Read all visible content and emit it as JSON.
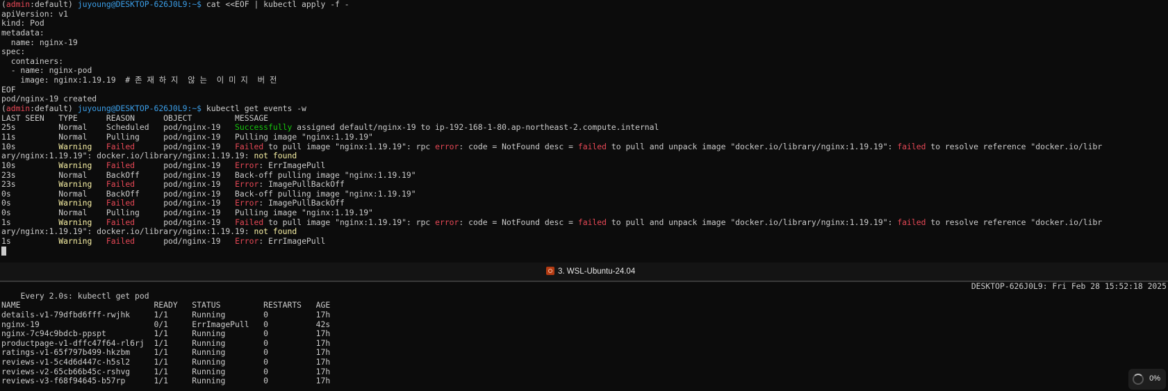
{
  "colors": {
    "background": "#0c0c0c",
    "text": "#cccccc",
    "red": "#e74856",
    "yellow": "#f9f1a5",
    "green": "#16c60c",
    "cyan": "#3b9ee8"
  },
  "prompt": {
    "open": "(",
    "user": "admin",
    "colon": ":",
    "ns": "default",
    "close": ") ",
    "host": "juyoung@DESKTOP-626J0L9:~$"
  },
  "top_lines": [
    [
      {
        "t": "(",
        "c": ""
      },
      {
        "t": "admin",
        "c": "red"
      },
      {
        "t": ":default) ",
        "c": ""
      },
      {
        "t": "juyoung@DESKTOP-626J0L9:~$",
        "c": "cyan"
      },
      {
        "t": " cat <<EOF | kubectl apply -f -",
        "c": ""
      }
    ],
    [
      {
        "t": "apiVersion: v1",
        "c": ""
      }
    ],
    [
      {
        "t": "kind: Pod",
        "c": ""
      }
    ],
    [
      {
        "t": "metadata:",
        "c": ""
      }
    ],
    [
      {
        "t": "  name: nginx-19",
        "c": ""
      }
    ],
    [
      {
        "t": "spec:",
        "c": ""
      }
    ],
    [
      {
        "t": "  containers:",
        "c": ""
      }
    ],
    [
      {
        "t": "  - name: nginx-pod",
        "c": ""
      }
    ],
    [
      {
        "t": "    image: nginx:1.19.19  # 존 재 하 지  않 는  이 미 지  버 전",
        "c": ""
      }
    ],
    [
      {
        "t": "EOF",
        "c": ""
      }
    ],
    [
      {
        "t": "pod/nginx-19 created",
        "c": ""
      }
    ],
    [
      {
        "t": "(",
        "c": ""
      },
      {
        "t": "admin",
        "c": "red"
      },
      {
        "t": ":default) ",
        "c": ""
      },
      {
        "t": "juyoung@DESKTOP-626J0L9:~$",
        "c": "cyan"
      },
      {
        "t": " kubectl get events -w",
        "c": ""
      }
    ],
    [
      {
        "t": "LAST SEEN   TYPE      REASON      OBJECT         MESSAGE",
        "c": ""
      }
    ],
    [
      {
        "t": "25s         Normal    Scheduled   pod/nginx-19   ",
        "c": ""
      },
      {
        "t": "Successfully",
        "c": "green"
      },
      {
        "t": " assigned default/nginx-19 to ip-192-168-1-80.ap-northeast-2.compute.internal",
        "c": ""
      }
    ],
    [
      {
        "t": "11s         Normal    Pulling     pod/nginx-19   Pulling image \"nginx:1.19.19\"",
        "c": ""
      }
    ],
    [
      {
        "t": "10s         ",
        "c": ""
      },
      {
        "t": "Warning",
        "c": "yellow"
      },
      {
        "t": "   ",
        "c": ""
      },
      {
        "t": "Failed",
        "c": "red"
      },
      {
        "t": "      pod/nginx-19   ",
        "c": ""
      },
      {
        "t": "Failed",
        "c": "red"
      },
      {
        "t": " to pull image \"nginx:1.19.19\": rpc ",
        "c": ""
      },
      {
        "t": "error",
        "c": "red"
      },
      {
        "t": ": code = NotFound desc = ",
        "c": ""
      },
      {
        "t": "failed",
        "c": "red"
      },
      {
        "t": " to pull and unpack image \"docker.io/library/nginx:1.19.19\": ",
        "c": ""
      },
      {
        "t": "failed",
        "c": "red"
      },
      {
        "t": " to resolve reference \"docker.io/libr",
        "c": ""
      }
    ],
    [
      {
        "t": "ary/nginx:1.19.19\": docker.io/library/nginx:1.19.19: ",
        "c": ""
      },
      {
        "t": "not found",
        "c": "yellow"
      }
    ],
    [
      {
        "t": "10s         ",
        "c": ""
      },
      {
        "t": "Warning",
        "c": "yellow"
      },
      {
        "t": "   ",
        "c": ""
      },
      {
        "t": "Failed",
        "c": "red"
      },
      {
        "t": "      pod/nginx-19   ",
        "c": ""
      },
      {
        "t": "Error",
        "c": "red"
      },
      {
        "t": ": ErrImagePull",
        "c": ""
      }
    ],
    [
      {
        "t": "23s         Normal    BackOff     pod/nginx-19   Back-off pulling image \"nginx:1.19.19\"",
        "c": ""
      }
    ],
    [
      {
        "t": "23s         ",
        "c": ""
      },
      {
        "t": "Warning",
        "c": "yellow"
      },
      {
        "t": "   ",
        "c": ""
      },
      {
        "t": "Failed",
        "c": "red"
      },
      {
        "t": "      pod/nginx-19   ",
        "c": ""
      },
      {
        "t": "Error",
        "c": "red"
      },
      {
        "t": ": ImagePullBackOff",
        "c": ""
      }
    ],
    [
      {
        "t": "0s          Normal    BackOff     pod/nginx-19   Back-off pulling image \"nginx:1.19.19\"",
        "c": ""
      }
    ],
    [
      {
        "t": "0s          ",
        "c": ""
      },
      {
        "t": "Warning",
        "c": "yellow"
      },
      {
        "t": "   ",
        "c": ""
      },
      {
        "t": "Failed",
        "c": "red"
      },
      {
        "t": "      pod/nginx-19   ",
        "c": ""
      },
      {
        "t": "Error",
        "c": "red"
      },
      {
        "t": ": ImagePullBackOff",
        "c": ""
      }
    ],
    [
      {
        "t": "0s          Normal    Pulling     pod/nginx-19   Pulling image \"nginx:1.19.19\"",
        "c": ""
      }
    ],
    [
      {
        "t": "1s          ",
        "c": ""
      },
      {
        "t": "Warning",
        "c": "yellow"
      },
      {
        "t": "   ",
        "c": ""
      },
      {
        "t": "Failed",
        "c": "red"
      },
      {
        "t": "      pod/nginx-19   ",
        "c": ""
      },
      {
        "t": "Failed",
        "c": "red"
      },
      {
        "t": " to pull image \"nginx:1.19.19\": rpc ",
        "c": ""
      },
      {
        "t": "error",
        "c": "red"
      },
      {
        "t": ": code = NotFound desc = ",
        "c": ""
      },
      {
        "t": "failed",
        "c": "red"
      },
      {
        "t": " to pull and unpack image \"docker.io/library/nginx:1.19.19\": ",
        "c": ""
      },
      {
        "t": "failed",
        "c": "red"
      },
      {
        "t": " to resolve reference \"docker.io/libr",
        "c": ""
      }
    ],
    [
      {
        "t": "ary/nginx:1.19.19\": docker.io/library/nginx:1.19.19: ",
        "c": ""
      },
      {
        "t": "not found",
        "c": "yellow"
      }
    ],
    [
      {
        "t": "1s          ",
        "c": ""
      },
      {
        "t": "Warning",
        "c": "yellow"
      },
      {
        "t": "   ",
        "c": ""
      },
      {
        "t": "Failed",
        "c": "red"
      },
      {
        "t": "      pod/nginx-19   ",
        "c": ""
      },
      {
        "t": "Error",
        "c": "red"
      },
      {
        "t": ": ErrImagePull",
        "c": ""
      }
    ]
  ],
  "tab": {
    "label": "3. WSL-Ubuntu-24.04",
    "icon": "terminal-app-icon"
  },
  "watch": {
    "left": "Every 2.0s: kubectl get pod",
    "right": "DESKTOP-626J0L9: Fri Feb 28 15:52:18 2025"
  },
  "pods": {
    "header": "NAME                            READY   STATUS         RESTARTS   AGE",
    "rows": [
      "details-v1-79dfbd6fff-rwjhk     1/1     Running        0          17h",
      "nginx-19                        0/1     ErrImagePull   0          42s",
      "nginx-7c94c9bdcb-ppspt          1/1     Running        0          17h",
      "productpage-v1-dffc47f64-rl6rj  1/1     Running        0          17h",
      "ratings-v1-65f797b499-hkzbm     1/1     Running        0          17h",
      "reviews-v1-5c4d6d447c-h5sl2     1/1     Running        0          17h",
      "reviews-v2-65cb66b45c-rshvg     1/1     Running        0          17h",
      "reviews-v3-f68f94645-b57rp      1/1     Running        0          17h"
    ]
  },
  "progress": {
    "label": "0%",
    "value": 0,
    "icon": "spinner-icon"
  }
}
